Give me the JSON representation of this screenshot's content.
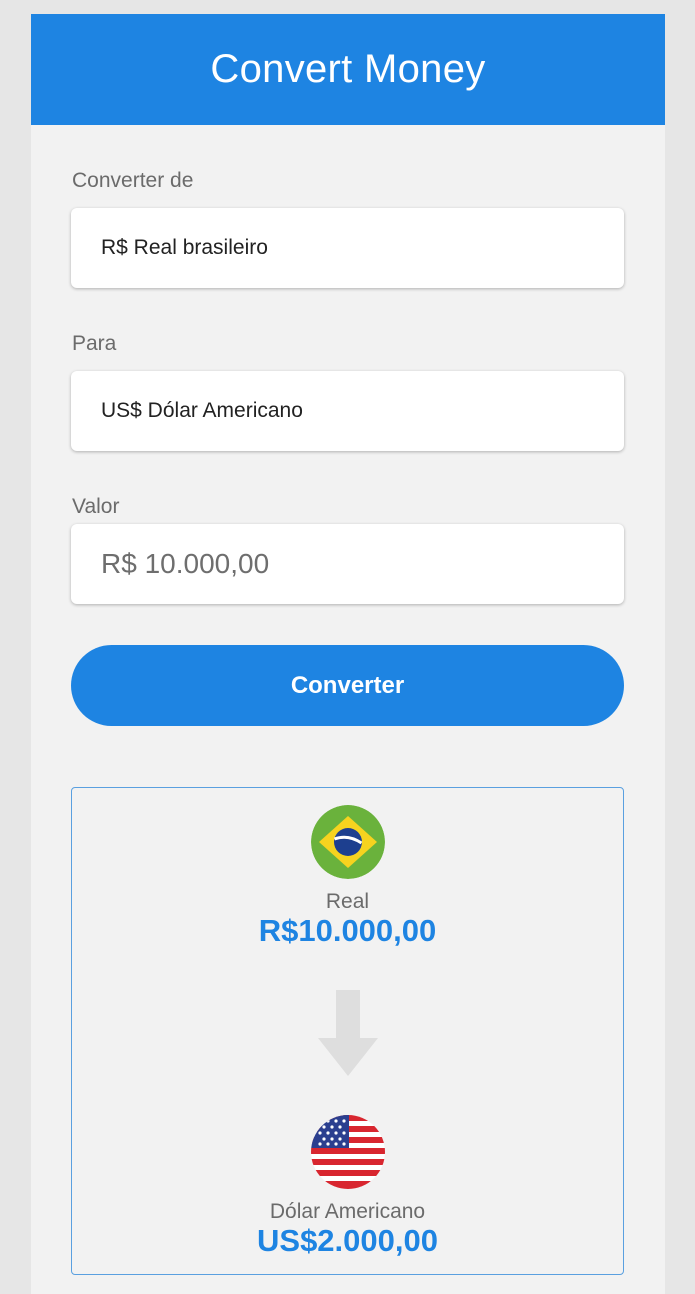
{
  "header": {
    "title": "Convert Money"
  },
  "form": {
    "from_label": "Converter de",
    "from_value": "R$ Real brasileiro",
    "to_label": "Para",
    "to_value": "US$ Dólar Americano",
    "amount_label": "Valor",
    "amount_placeholder": "R$ 10.000,00",
    "convert_button": "Converter"
  },
  "result": {
    "from_currency": {
      "name": "Real",
      "amount": "R$10.000,00",
      "flag": "brazil-flag-icon"
    },
    "arrow_icon": "arrow-down-icon",
    "to_currency": {
      "name": "Dólar Americano",
      "amount": "US$2.000,00",
      "flag": "usa-flag-icon"
    }
  },
  "colors": {
    "primary": "#1e84e2",
    "background": "#f2f2f2",
    "result_border": "#5aa0e0",
    "arrow": "#dedede"
  }
}
